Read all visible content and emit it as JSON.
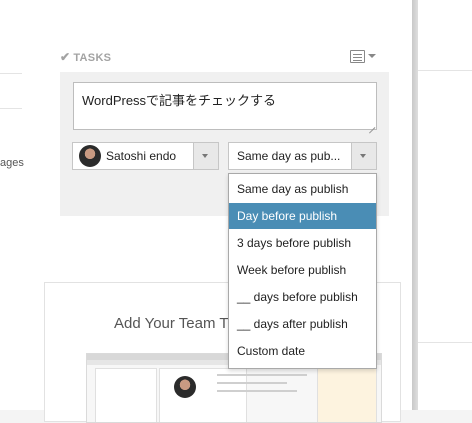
{
  "sidebar": {
    "fragment_text": "ages"
  },
  "tasks": {
    "title": "TASKS",
    "task_text": "WordPressで記事をチェックする",
    "assignee": {
      "name": "Satoshi endo"
    },
    "due_select": {
      "value": "Same day as pub..."
    },
    "dropdown": {
      "options": [
        "Same day as publish",
        "Day before publish",
        "3 days before publish",
        "Week before publish",
        "__ days before publish",
        "__ days after publish",
        "Custom date"
      ],
      "selected_index": 1
    }
  },
  "card": {
    "title": "Add Your Team T"
  },
  "colors": {
    "accent": "#4a8db5",
    "panel_bg": "#f0f0f0"
  },
  "icons": {
    "check": "check-icon",
    "menu": "list-menu-icon"
  }
}
